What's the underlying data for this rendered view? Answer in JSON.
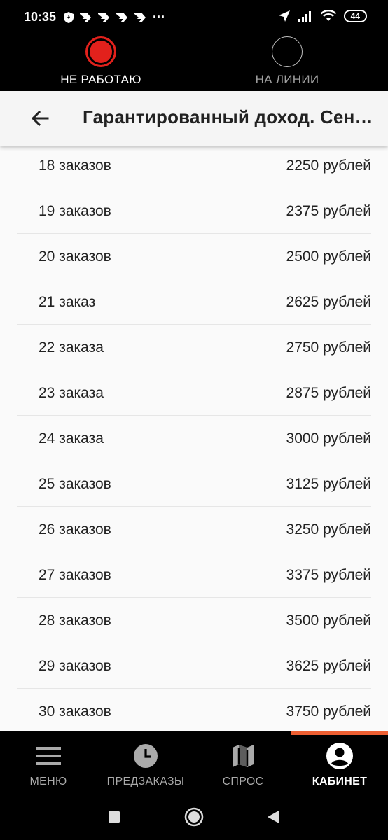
{
  "status_bar": {
    "time": "10:35",
    "battery": "44",
    "more": "···"
  },
  "driver_status": {
    "off_label": "НЕ РАБОТАЮ",
    "on_label": "НА ЛИНИИ",
    "off_color": "#e2211c"
  },
  "header": {
    "title": "Гарантированный доход. Сентябрь"
  },
  "rows": [
    {
      "orders": "18 заказов",
      "amount": "2250 рублей"
    },
    {
      "orders": "19 заказов",
      "amount": "2375 рублей"
    },
    {
      "orders": "20 заказов",
      "amount": "2500 рублей"
    },
    {
      "orders": "21 заказ",
      "amount": "2625 рублей"
    },
    {
      "orders": "22 заказа",
      "amount": "2750 рублей"
    },
    {
      "orders": "23 заказа",
      "amount": "2875 рублей"
    },
    {
      "orders": "24 заказа",
      "amount": "3000 рублей"
    },
    {
      "orders": "25 заказов",
      "amount": "3125 рублей"
    },
    {
      "orders": "26 заказов",
      "amount": "3250 рублей"
    },
    {
      "orders": "27 заказов",
      "amount": "3375 рублей"
    },
    {
      "orders": "28 заказов",
      "amount": "3500 рублей"
    },
    {
      "orders": "29 заказов",
      "amount": "3625 рублей"
    },
    {
      "orders": "30 заказов",
      "amount": "3750 рублей"
    }
  ],
  "bottom_nav": {
    "menu": "МЕНЮ",
    "preorders": "ПРЕДЗАКАЗЫ",
    "demand": "СПРОС",
    "cabinet": "КАБИНЕТ",
    "accent": "#ee5f32"
  }
}
